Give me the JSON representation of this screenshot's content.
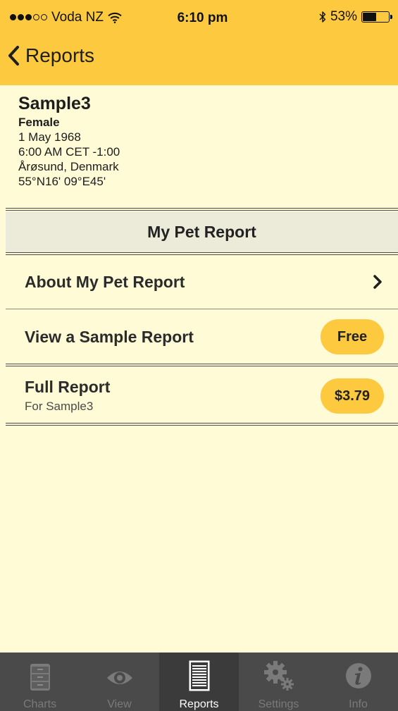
{
  "status_bar": {
    "carrier": "Voda NZ",
    "time": "6:10 pm",
    "battery_percent": "53%",
    "battery_level": 0.53,
    "signal_bars_filled": 3,
    "signal_bars_total": 5
  },
  "nav": {
    "back_label": "Reports"
  },
  "profile": {
    "name": "Sample3",
    "gender": "Female",
    "date": "1 May 1968",
    "time": "6:00 AM CET -1:00",
    "place": "Årøsund, Denmark",
    "coordinates": "55°N16' 09°E45'"
  },
  "section": {
    "title": "My Pet Report"
  },
  "rows": {
    "about": {
      "label": "About My Pet Report"
    },
    "sample": {
      "label": "View a Sample Report",
      "badge": "Free"
    },
    "full": {
      "title": "Full Report",
      "subtitle": "For Sample3",
      "price": "$3.79"
    }
  },
  "tabbar": {
    "tabs": [
      {
        "label": "Charts",
        "icon": "file-cabinet-icon"
      },
      {
        "label": "View",
        "icon": "eye-icon"
      },
      {
        "label": "Reports",
        "icon": "document-icon"
      },
      {
        "label": "Settings",
        "icon": "gears-icon"
      },
      {
        "label": "Info",
        "icon": "info-icon"
      }
    ],
    "active": "Reports"
  },
  "colors": {
    "accent": "#fdc93f",
    "background": "#fefbd6",
    "section_header": "#ecebd9",
    "tabbar": "#4a4a4a"
  }
}
